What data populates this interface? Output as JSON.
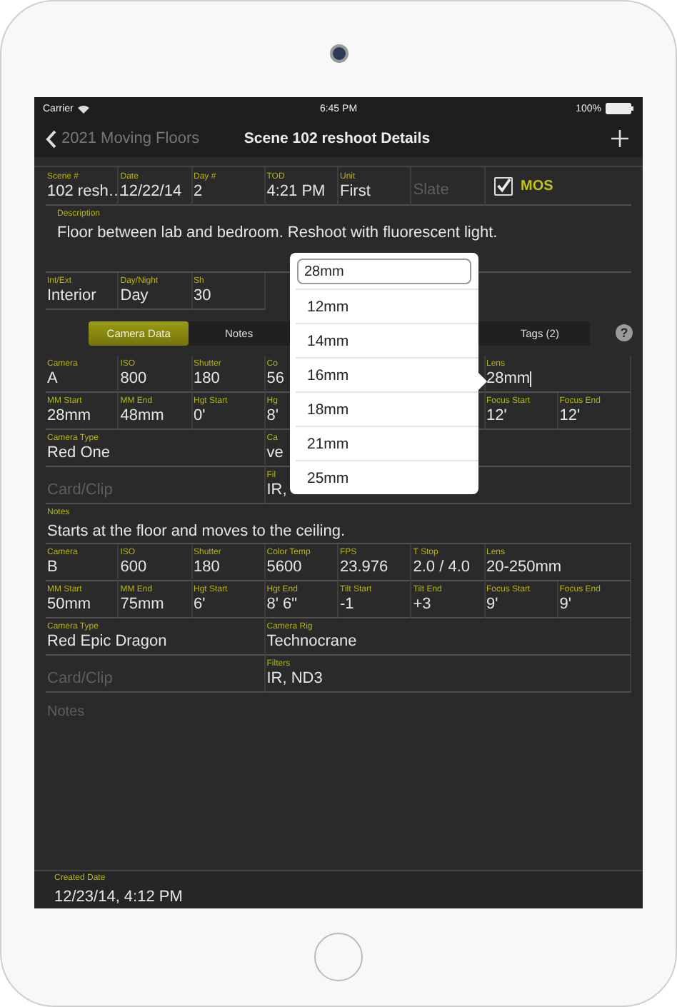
{
  "status_bar": {
    "carrier": "Carrier",
    "time": "6:45 PM",
    "battery": "100%"
  },
  "nav": {
    "back": "2021 Moving Floors",
    "title": "Scene 102 reshoot Details"
  },
  "scene_fields": [
    {
      "label": "Scene #",
      "value": "102 resh…"
    },
    {
      "label": "Date",
      "value": "12/22/14"
    },
    {
      "label": "Day #",
      "value": "2"
    },
    {
      "label": "TOD",
      "value": "4:21 PM"
    },
    {
      "label": "Unit",
      "value": "First"
    },
    {
      "placeholder": "Slate"
    }
  ],
  "mos": {
    "label": "MOS",
    "checked": true
  },
  "description": {
    "label": "Description",
    "value": "Floor between lab and bedroom. Reshoot with fluorescent light."
  },
  "scene_info_fields": [
    {
      "label": "Int/Ext",
      "value": "Interior"
    },
    {
      "label": "Day/Night",
      "value": "Day"
    },
    {
      "label": "Sh",
      "value": "30"
    }
  ],
  "tabs": [
    {
      "label": "Camera Data",
      "selected": true
    },
    {
      "label": "Notes",
      "selected": false
    },
    {
      "label": "Tags (2)",
      "selected": false
    }
  ],
  "help": "?",
  "cameras": [
    {
      "rows": [
        [
          {
            "label": "Camera",
            "value": "A"
          },
          {
            "label": "ISO",
            "value": "800"
          },
          {
            "label": "Shutter",
            "value": "180"
          },
          {
            "label": "Co",
            "value": "56"
          },
          null,
          null,
          {
            "label": "Lens",
            "value": "28mm",
            "editing": true
          }
        ],
        [
          {
            "label": "MM Start",
            "value": "28mm"
          },
          {
            "label": "MM End",
            "value": "48mm"
          },
          {
            "label": "Hgt Start",
            "value": "0'"
          },
          {
            "label": "Hg",
            "value": "8'"
          },
          null,
          null,
          {
            "label": "Focus Start",
            "value": "12'"
          },
          {
            "label": "Focus End",
            "value": "12'"
          }
        ],
        [
          {
            "label": "Camera Type",
            "value": "Red One"
          },
          {
            "label": "Ca",
            "value": "ve"
          }
        ],
        [
          {
            "placeholder": "Card/Clip"
          },
          {
            "label": "Fil",
            "value": "IR,"
          }
        ]
      ],
      "notes": {
        "label": "Notes",
        "value": "Starts at the floor and moves to the ceiling."
      }
    },
    {
      "rows": [
        [
          {
            "label": "Camera",
            "value": "B"
          },
          {
            "label": "ISO",
            "value": "600"
          },
          {
            "label": "Shutter",
            "value": "180"
          },
          {
            "label": "Color Temp",
            "value": "5600"
          },
          {
            "label": "FPS",
            "value": "23.976"
          },
          {
            "label": "T Stop",
            "value": "2.0 / 4.0"
          },
          {
            "label": "Lens",
            "value": "20-250mm"
          }
        ],
        [
          {
            "label": "MM Start",
            "value": "50mm"
          },
          {
            "label": "MM End",
            "value": "75mm"
          },
          {
            "label": "Hgt Start",
            "value": "6'"
          },
          {
            "label": "Hgt End",
            "value": "8' 6\""
          },
          {
            "label": "Tilt Start",
            "value": "-1"
          },
          {
            "label": "Tilt End",
            "value": "+3"
          },
          {
            "label": "Focus Start",
            "value": "9'"
          },
          {
            "label": "Focus End",
            "value": "9'"
          }
        ],
        [
          {
            "label": "Camera Type",
            "value": "Red Epic Dragon"
          },
          {
            "label": "Camera Rig",
            "value": "Technocrane"
          }
        ],
        [
          {
            "placeholder": "Card/Clip"
          },
          {
            "label": "Filters",
            "value": "IR, ND3"
          }
        ]
      ],
      "notes": {
        "placeholder": "Notes"
      }
    }
  ],
  "created": {
    "label": "Created Date",
    "value": "12/23/14, 4:12 PM"
  },
  "popover": {
    "query": "28mm",
    "options": [
      "12mm",
      "14mm",
      "16mm",
      "18mm",
      "21mm",
      "25mm"
    ]
  }
}
